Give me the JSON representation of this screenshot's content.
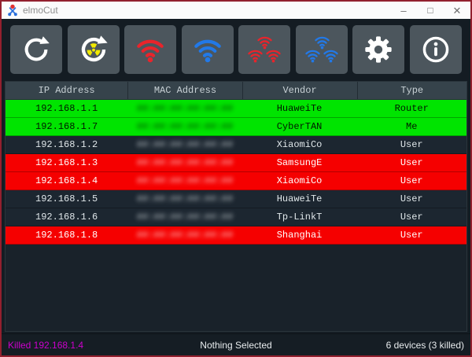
{
  "window": {
    "title": "elmoCut",
    "controls": {
      "minimize": "–",
      "maximize": "□",
      "close": "✕"
    }
  },
  "toolbar": {
    "buttons": [
      {
        "id": "refresh",
        "icon": "refresh-icon"
      },
      {
        "id": "kill-scan",
        "icon": "refresh-radioactive-icon"
      },
      {
        "id": "kill",
        "icon": "wifi-red-icon"
      },
      {
        "id": "unkill",
        "icon": "wifi-blue-icon"
      },
      {
        "id": "kill-all",
        "icon": "wifi-multi-red-icon"
      },
      {
        "id": "unkill-all",
        "icon": "wifi-multi-blue-icon"
      },
      {
        "id": "settings",
        "icon": "gear-icon"
      },
      {
        "id": "about",
        "icon": "info-icon"
      }
    ]
  },
  "table": {
    "headers": [
      "IP Address",
      "MAC Address",
      "Vendor",
      "Type"
    ],
    "rows": [
      {
        "ip": "192.168.1.1",
        "mac": "##:##:##:##:##:##",
        "mac_redacted": true,
        "vendor": "HuaweiTe",
        "type": "Router",
        "state": "green"
      },
      {
        "ip": "192.168.1.7",
        "mac": "##:##:##:##:##:##",
        "mac_redacted": true,
        "vendor": "CyberTAN",
        "type": "Me",
        "state": "green"
      },
      {
        "ip": "192.168.1.2",
        "mac": "##:##:##:##:##:##",
        "mac_redacted": true,
        "vendor": "XiaomiCo",
        "type": "User",
        "state": "normal"
      },
      {
        "ip": "192.168.1.3",
        "mac": "##:##:##:##:##:##",
        "mac_redacted": true,
        "vendor": "SamsungE",
        "type": "User",
        "state": "killed"
      },
      {
        "ip": "192.168.1.4",
        "mac": "##:##:##:##:##:##",
        "mac_redacted": true,
        "vendor": "XiaomiCo",
        "type": "User",
        "state": "killed"
      },
      {
        "ip": "192.168.1.5",
        "mac": "##:##:##:##:##:##",
        "mac_redacted": true,
        "vendor": "HuaweiTe",
        "type": "User",
        "state": "normal"
      },
      {
        "ip": "192.168.1.6",
        "mac": "##:##:##:##:##:##",
        "mac_redacted": true,
        "vendor": "Tp-LinkT",
        "type": "User",
        "state": "normal"
      },
      {
        "ip": "192.168.1.8",
        "mac": "##:##:##:##:##:##",
        "mac_redacted": true,
        "vendor": "Shanghai",
        "type": "User",
        "state": "killed"
      }
    ]
  },
  "statusbar": {
    "left": "Killed 192.168.1.4",
    "center": "Nothing Selected",
    "right": "6 devices (3 killed)"
  },
  "colors": {
    "window_border": "#93202e",
    "button_bg": "#4c565d",
    "header_bg": "#36434b",
    "row_green": "#00e400",
    "row_red": "#f50000",
    "wifi_red": "#e8242b",
    "wifi_blue": "#2279e8",
    "radioactive_yellow": "#f2ea00",
    "status_magenta": "#cc00cc"
  }
}
